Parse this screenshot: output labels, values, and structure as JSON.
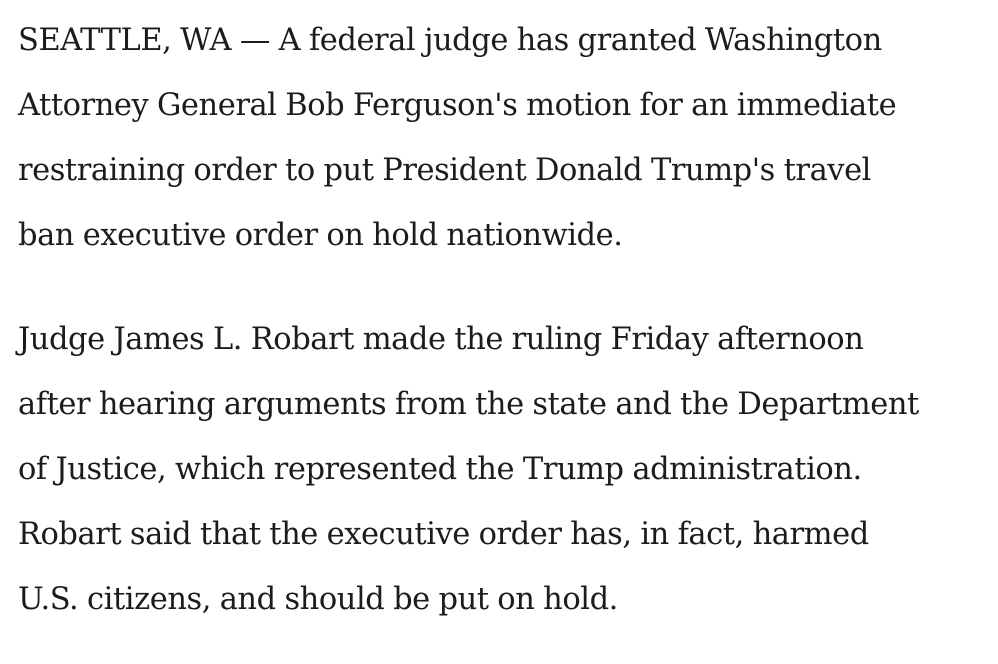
{
  "article": {
    "paragraphs": [
      {
        "lines": [
          "SEATTLE, WA — A federal judge has granted Washington",
          "Attorney General Bob Ferguson's motion for an immediate",
          "restraining order to put President Donald Trump's travel",
          "ban executive order on hold nationwide."
        ]
      },
      {
        "lines": [
          "Judge James L. Robart made the ruling Friday afternoon",
          "after hearing arguments from the state and the Department",
          "of Justice, which represented the Trump administration.",
          "Robart said that the executive order has, in fact, harmed",
          "U.S. citizens, and should be put on hold."
        ]
      }
    ]
  }
}
